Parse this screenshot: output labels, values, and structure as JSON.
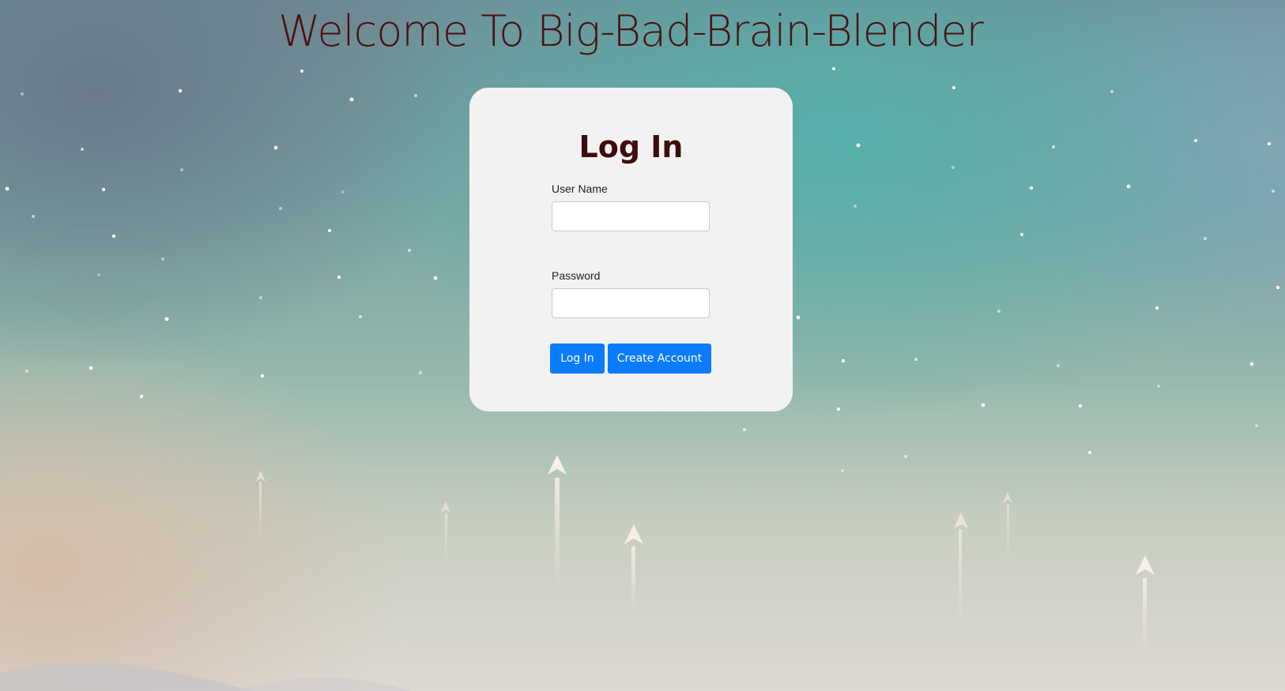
{
  "header": {
    "title": "Welcome To Big-Bad-Brain-Blender"
  },
  "login_form": {
    "heading": "Log In",
    "username_label": "User Name",
    "username_value": "",
    "password_label": "Password",
    "password_value": "",
    "login_button": "Log In",
    "create_account_button": "Create Account"
  },
  "colors": {
    "button": "#0a7cff",
    "title_text": "#4a1212",
    "heading_text": "#3e0c0c",
    "card_background": "#f2f2f2"
  }
}
